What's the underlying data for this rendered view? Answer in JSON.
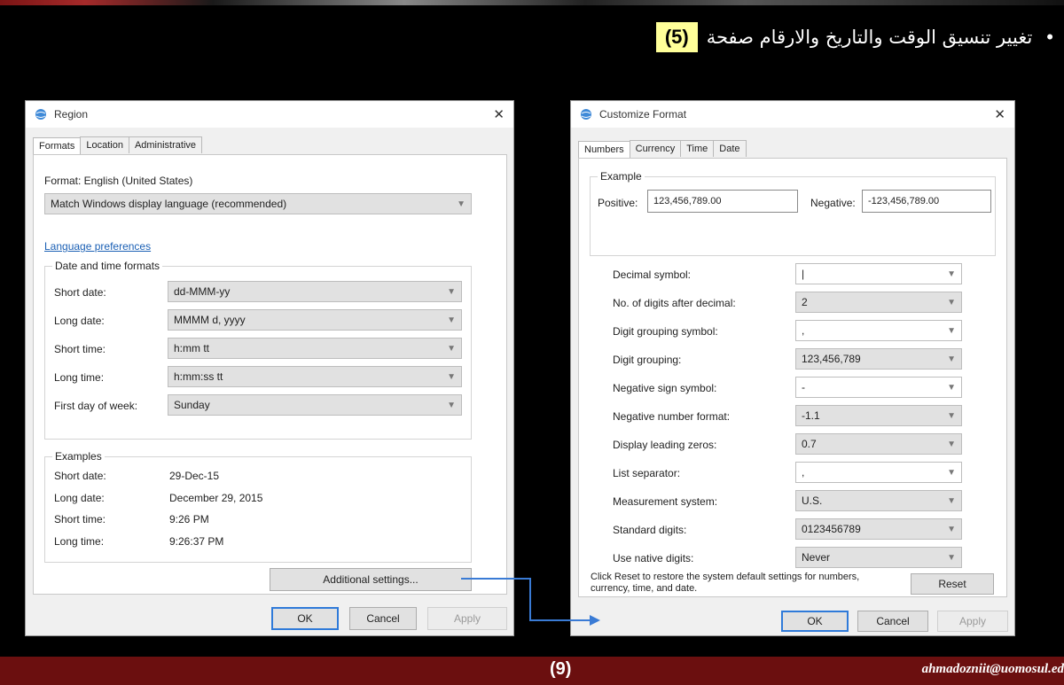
{
  "heading": {
    "badge": "(5)",
    "text": "تغيير تنسيق الوقت والتاريخ والارقام صفحة",
    "bullet": "•"
  },
  "footer": {
    "page_number": "(9)",
    "email": "ahmadozniit@uomosul.ed"
  },
  "region": {
    "title": "Region",
    "close": "✕",
    "tabs": [
      "Formats",
      "Location",
      "Administrative"
    ],
    "format_label": "Format: English (United States)",
    "format_value": "Match Windows display language (recommended)",
    "language_link": "Language preferences",
    "dt_group_title": "Date and time formats",
    "dt_rows": [
      {
        "label": "Short date:",
        "value": "dd-MMM-yy"
      },
      {
        "label": "Long date:",
        "value": "MMMM d, yyyy"
      },
      {
        "label": "Short time:",
        "value": "h:mm tt"
      },
      {
        "label": "Long time:",
        "value": "h:mm:ss tt"
      },
      {
        "label": "First day of week:",
        "value": "Sunday"
      }
    ],
    "examples_title": "Examples",
    "examples": [
      {
        "label": "Short date:",
        "value": "29-Dec-15"
      },
      {
        "label": "Long date:",
        "value": "December 29, 2015"
      },
      {
        "label": "Short time:",
        "value": "9:26 PM"
      },
      {
        "label": "Long time:",
        "value": "9:26:37 PM"
      }
    ],
    "additional_settings": "Additional settings...",
    "ok": "OK",
    "cancel": "Cancel",
    "apply": "Apply"
  },
  "customize": {
    "title": "Customize Format",
    "close": "✕",
    "tabs": [
      "Numbers",
      "Currency",
      "Time",
      "Date"
    ],
    "example_title": "Example",
    "positive_label": "Positive:",
    "positive_value": "123,456,789.00",
    "negative_label": "Negative:",
    "negative_value": "-123,456,789.00",
    "rows": [
      {
        "label": "Decimal symbol:",
        "value": "|"
      },
      {
        "label": "No. of digits after decimal:",
        "value": "2"
      },
      {
        "label": "Digit grouping symbol:",
        "value": ","
      },
      {
        "label": "Digit grouping:",
        "value": "123,456,789"
      },
      {
        "label": "Negative sign symbol:",
        "value": "-"
      },
      {
        "label": "Negative number format:",
        "value": "-1.1"
      },
      {
        "label": "Display leading zeros:",
        "value": "0.7"
      },
      {
        "label": "List separator:",
        "value": ","
      },
      {
        "label": "Measurement system:",
        "value": "U.S."
      },
      {
        "label": "Standard digits:",
        "value": "0123456789"
      },
      {
        "label": "Use native digits:",
        "value": "Never"
      }
    ],
    "reset_text": "Click Reset to restore the system default settings for numbers, currency, time, and date.",
    "reset": "Reset",
    "ok": "OK",
    "cancel": "Cancel",
    "apply": "Apply"
  },
  "colors": {
    "footer_bg": "#6b0f0f",
    "badge_bg": "#ffff99",
    "accent": "#2f7ad9"
  },
  "icons": {
    "region_icon": "globe-icon",
    "customize_icon": "globe-icon",
    "dropdown": "chevron-down-icon"
  }
}
